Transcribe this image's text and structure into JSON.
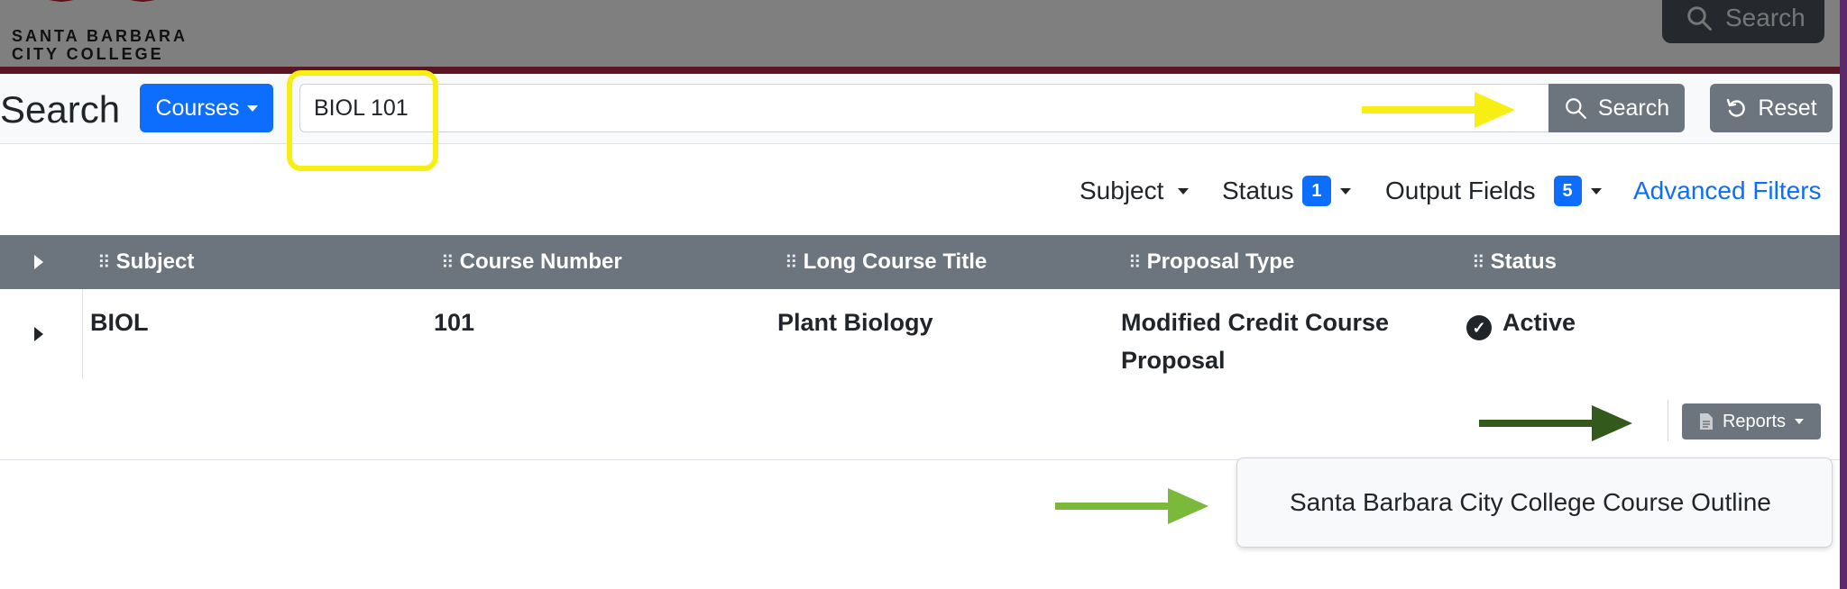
{
  "header": {
    "logo_text_line1": "SANTA BARBARA",
    "logo_text_line2": "CITY COLLEGE",
    "top_search_label": "Search"
  },
  "search": {
    "title": "Search",
    "scope_button": "Courses",
    "query_value": "BIOL 101",
    "search_button": "Search",
    "reset_button": "Reset"
  },
  "filters": {
    "subject": "Subject",
    "status": "Status",
    "status_count": "1",
    "output_fields": "Output Fields",
    "output_fields_count": "5",
    "advanced": "Advanced Filters"
  },
  "table": {
    "columns": [
      "Subject",
      "Course Number",
      "Long Course Title",
      "Proposal Type",
      "Status"
    ],
    "rows": [
      {
        "subject": "BIOL",
        "course_number": "101",
        "title": "Plant Biology",
        "proposal_type": "Modified Credit Course Proposal",
        "status": "Active"
      }
    ]
  },
  "reports": {
    "button": "Reports",
    "menu_items": [
      "Santa Barbara City College Course Outline"
    ]
  },
  "colors": {
    "primary": "#0d6efd",
    "secondary": "#6c757d",
    "brand_maroon": "#5a1622",
    "highlight_yellow": "#f7ef13",
    "arrow_dark_green": "#335a1c",
    "arrow_light_green": "#7ab93a"
  }
}
